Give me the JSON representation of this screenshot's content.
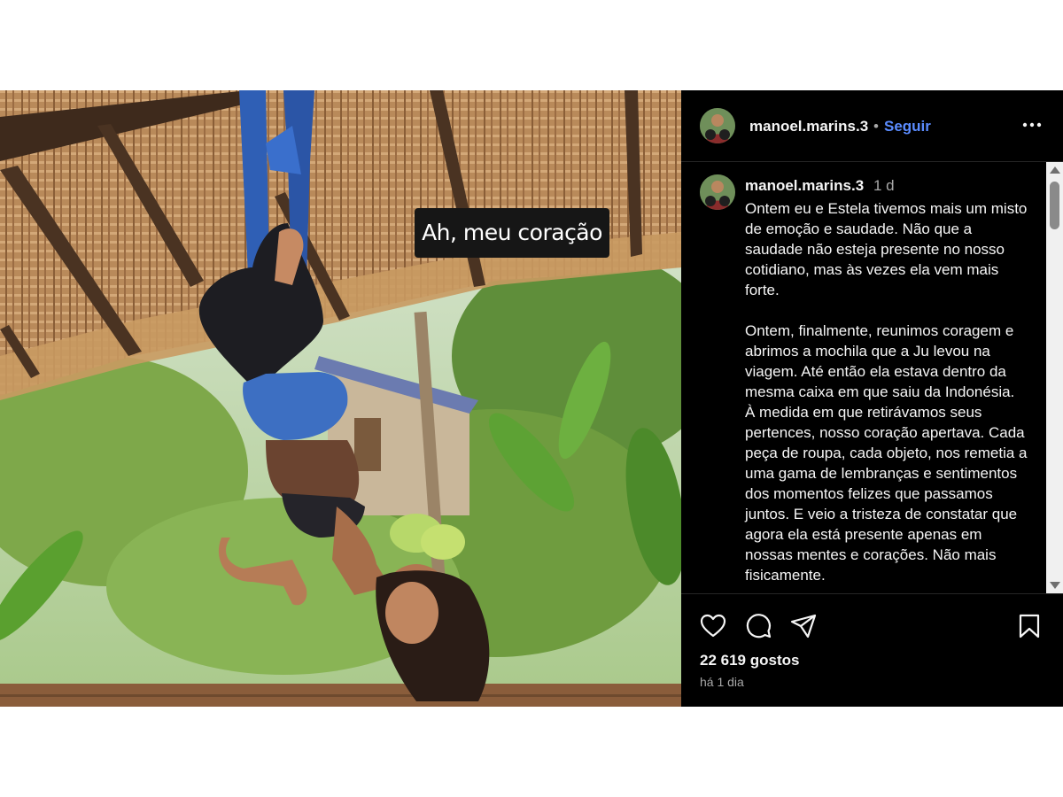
{
  "photo": {
    "caption_sticker": "Ah, meu coração"
  },
  "header": {
    "username": "manoel.marins.3",
    "separator": "•",
    "follow_label": "Seguir",
    "more_icon": "more-horizontal-icon"
  },
  "comment": {
    "username": "manoel.marins.3",
    "time": "1 d",
    "paragraphs": [
      "Ontem eu e Estela tivemos mais um misto de emoção e saudade. Não que a saudade não esteja presente no nosso cotidiano, mas às vezes ela vem mais forte.",
      "Ontem, finalmente, reunimos coragem e abrimos a mochila que a Ju levou na viagem. Até então ela estava dentro da mesma caixa em que saiu da Indonésia. À medida em que retirávamos seus pertences, nosso coração apertava. Cada peça de roupa, cada objeto, nos remetia a uma gama de lembranças e sentimentos dos momentos felizes que passamos juntos. E veio a tristeza de constatar que agora ela está presente apenas em nossas mentes e corações. Não mais fisicamente."
    ]
  },
  "actions": {
    "icons": [
      "heart-icon",
      "comment-icon",
      "share-icon",
      "bookmark-icon"
    ],
    "likes": "22 619 gostos",
    "posted_ago": "há 1 dia"
  },
  "colors": {
    "panel_bg": "#000000",
    "text": "#f5f5f5",
    "muted": "#a8a8a8",
    "follow": "#5b8cff"
  }
}
